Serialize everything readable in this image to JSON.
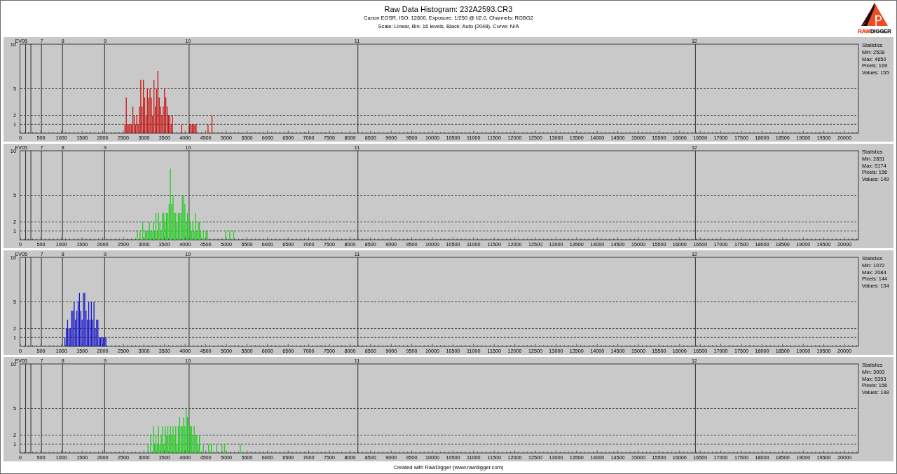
{
  "header": {
    "title": "Raw Data Histogram: 232A2593.CR3",
    "lines": [
      "Canon EOSR, ISO: 12800, Exposure: 1/250 @ f/2.0, Channels: RGBG2",
      "Scale: Linear, Bin: 16 levels, Black: Auto (2048), Curve: N/A"
    ]
  },
  "logo": {
    "wordmark": [
      {
        "text": "RAW",
        "color": "#e8421e"
      },
      {
        "text": "DIGGER",
        "color": "#222222"
      }
    ]
  },
  "panels": [
    {
      "chart_data": {
        "type": "bar",
        "x": [
          2528,
          2560,
          2592,
          2624,
          2656,
          2688,
          2720,
          2752,
          2784,
          2816,
          2848,
          2880,
          2912,
          2944,
          2976,
          3008,
          3040,
          3072,
          3104,
          3136,
          3168,
          3200,
          3232,
          3264,
          3296,
          3328,
          3360,
          3392,
          3424,
          3456,
          3488,
          3520,
          3552,
          3584,
          3616,
          3648,
          3680,
          3904,
          4096,
          4128,
          4160,
          4192,
          4224,
          4256,
          4544,
          4640
        ],
        "series": [
          {
            "color": "#c81414",
            "values": [
              1,
              4,
              1,
              1,
              1,
              1,
              3,
              2,
              1,
              2,
              1,
              3,
              6,
              3,
              6,
              4,
              2,
              5,
              4,
              5,
              4,
              2,
              6,
              3,
              5,
              7,
              4,
              3,
              2,
              3,
              5,
              4,
              3,
              2,
              2,
              1,
              2,
              1,
              1,
              1,
              1,
              1,
              1,
              1,
              1,
              2
            ]
          }
        ],
        "xlim": [
          0,
          20340
        ],
        "ylim": [
          0,
          10
        ],
        "grid": "y",
        "xticks": [
          0,
          500,
          1000,
          1500,
          2000,
          2500,
          3000,
          3500,
          4000,
          4500,
          5000,
          5500,
          6000,
          6500,
          7000,
          7500,
          8000,
          8500,
          9000,
          9500,
          10000,
          10500,
          11000,
          11500,
          12000,
          12500,
          13000,
          13500,
          14000,
          14500,
          15000,
          15500,
          16000,
          16500,
          17000,
          17500,
          18000,
          18500,
          19000,
          19500,
          20000
        ],
        "yticks": [
          1,
          2,
          5,
          10
        ],
        "ref_lines": [
          {
            "axis": "x",
            "value": 128
          },
          {
            "axis": "x",
            "value": 256
          },
          {
            "axis": "x",
            "value": 512
          },
          {
            "axis": "x",
            "value": 1024
          },
          {
            "axis": "x",
            "value": 2048
          },
          {
            "axis": "x",
            "value": 4096
          },
          {
            "axis": "x",
            "value": 8192
          },
          {
            "axis": "x",
            "value": 16384
          }
        ],
        "annotations": [
          {
            "x": 128,
            "y": 10,
            "text": "EV05"
          },
          {
            "x": 512,
            "y": 10,
            "text": "7"
          },
          {
            "x": 1024,
            "y": 10,
            "text": "8"
          },
          {
            "x": 2048,
            "y": 10,
            "text": "9"
          },
          {
            "x": 4096,
            "y": 10,
            "text": "10"
          },
          {
            "x": 8192,
            "y": 10,
            "text": "11"
          },
          {
            "x": 16384,
            "y": 10,
            "text": "12"
          }
        ]
      },
      "statistics": {
        "heading": "Statistics",
        "lines": [
          "Min: 2528",
          "Max: 4650",
          "Pixels: 169",
          "Values: 155"
        ]
      }
    },
    {
      "chart_data": {
        "type": "bar",
        "x": [
          2832,
          2896,
          2960,
          3024,
          3056,
          3088,
          3120,
          3152,
          3184,
          3216,
          3248,
          3280,
          3312,
          3344,
          3376,
          3408,
          3440,
          3472,
          3504,
          3536,
          3568,
          3600,
          3632,
          3664,
          3696,
          3728,
          3760,
          3792,
          3824,
          3856,
          3888,
          3920,
          3952,
          3984,
          4016,
          4048,
          4080,
          4112,
          4144,
          4176,
          4208,
          4240,
          4272,
          4304,
          4336,
          4368,
          4432,
          4496,
          4528,
          4976,
          5072,
          5168
        ],
        "series": [
          {
            "color": "#22cc22",
            "values": [
              1,
              1,
              2,
              1,
              1,
              1,
              2,
              1,
              1,
              2,
              1,
              3,
              1,
              3,
              2,
              1,
              3,
              3,
              2,
              3,
              3,
              4,
              8,
              4,
              5,
              3,
              3,
              2,
              3,
              3,
              3,
              5,
              5,
              4,
              2,
              3,
              3,
              2,
              1,
              2,
              1,
              3,
              1,
              2,
              2,
              1,
              1,
              1,
              1,
              1,
              1,
              1
            ]
          }
        ],
        "xlim": [
          0,
          20340
        ],
        "ylim": [
          0,
          10
        ],
        "grid": "y",
        "xticks": [
          0,
          500,
          1000,
          1500,
          2000,
          2500,
          3000,
          3500,
          4000,
          4500,
          5000,
          5500,
          6000,
          6500,
          7000,
          7500,
          8000,
          8500,
          9000,
          9500,
          10000,
          10500,
          11000,
          11500,
          12000,
          12500,
          13000,
          13500,
          14000,
          14500,
          15000,
          15500,
          16000,
          16500,
          17000,
          17500,
          18000,
          18500,
          19000,
          19500,
          20000
        ],
        "yticks": [
          1,
          2,
          5,
          10
        ],
        "ref_lines": [
          {
            "axis": "x",
            "value": 128
          },
          {
            "axis": "x",
            "value": 256
          },
          {
            "axis": "x",
            "value": 512
          },
          {
            "axis": "x",
            "value": 1024
          },
          {
            "axis": "x",
            "value": 2048
          },
          {
            "axis": "x",
            "value": 4096
          },
          {
            "axis": "x",
            "value": 8192
          },
          {
            "axis": "x",
            "value": 16384
          }
        ],
        "annotations": [
          {
            "x": 128,
            "y": 10,
            "text": "EV05"
          },
          {
            "x": 512,
            "y": 10,
            "text": "7"
          },
          {
            "x": 1024,
            "y": 10,
            "text": "8"
          },
          {
            "x": 2048,
            "y": 10,
            "text": "9"
          },
          {
            "x": 4096,
            "y": 10,
            "text": "10"
          },
          {
            "x": 8192,
            "y": 10,
            "text": "11"
          },
          {
            "x": 16384,
            "y": 10,
            "text": "12"
          }
        ]
      },
      "statistics": {
        "heading": "Statistics",
        "lines": [
          "Min: 2831",
          "Max: 5174",
          "Pixels: 156",
          "Values: 149"
        ]
      }
    },
    {
      "chart_data": {
        "type": "bar",
        "x": [
          1072,
          1104,
          1136,
          1168,
          1200,
          1232,
          1264,
          1296,
          1328,
          1360,
          1392,
          1424,
          1456,
          1488,
          1520,
          1552,
          1584,
          1616,
          1648,
          1680,
          1712,
          1744,
          1776,
          1808,
          1840,
          1872,
          1904,
          1936,
          1968,
          2000,
          2032,
          2064
        ],
        "series": [
          {
            "color": "#1414c8",
            "values": [
              1,
              2,
              3,
              2,
              2,
              4,
              4,
              5,
              3,
              4,
              5,
              6,
              4,
              3,
              6,
              6,
              4,
              3,
              5,
              3,
              5,
              3,
              5,
              2,
              3,
              3,
              1,
              1,
              1,
              1,
              1,
              1
            ]
          }
        ],
        "xlim": [
          0,
          20340
        ],
        "ylim": [
          0,
          10
        ],
        "grid": "y",
        "xticks": [
          0,
          500,
          1000,
          1500,
          2000,
          2500,
          3000,
          3500,
          4000,
          4500,
          5000,
          5500,
          6000,
          6500,
          7000,
          7500,
          8000,
          8500,
          9000,
          9500,
          10000,
          10500,
          11000,
          11500,
          12000,
          12500,
          13000,
          13500,
          14000,
          14500,
          15000,
          15500,
          16000,
          16500,
          17000,
          17500,
          18000,
          18500,
          19000,
          19500,
          20000
        ],
        "yticks": [
          1,
          2,
          5,
          10
        ],
        "ref_lines": [
          {
            "axis": "x",
            "value": 128
          },
          {
            "axis": "x",
            "value": 256
          },
          {
            "axis": "x",
            "value": 512
          },
          {
            "axis": "x",
            "value": 1024
          },
          {
            "axis": "x",
            "value": 2048
          },
          {
            "axis": "x",
            "value": 4096
          },
          {
            "axis": "x",
            "value": 8192
          },
          {
            "axis": "x",
            "value": 16384
          }
        ],
        "annotations": [
          {
            "x": 128,
            "y": 10,
            "text": "EV05"
          },
          {
            "x": 512,
            "y": 10,
            "text": "7"
          },
          {
            "x": 1024,
            "y": 10,
            "text": "8"
          },
          {
            "x": 2048,
            "y": 10,
            "text": "9"
          },
          {
            "x": 4096,
            "y": 10,
            "text": "10"
          },
          {
            "x": 8192,
            "y": 10,
            "text": "11"
          },
          {
            "x": 16384,
            "y": 10,
            "text": "12"
          }
        ]
      },
      "statistics": {
        "heading": "Statistics",
        "lines": [
          "Min: 1072",
          "Max: 2084",
          "Pixels: 144",
          "Values: 134"
        ]
      }
    },
    {
      "chart_data": {
        "type": "bar",
        "x": [
          3088,
          3152,
          3216,
          3248,
          3280,
          3312,
          3344,
          3376,
          3408,
          3440,
          3472,
          3504,
          3536,
          3568,
          3600,
          3632,
          3664,
          3696,
          3728,
          3760,
          3792,
          3824,
          3856,
          3888,
          3920,
          3952,
          3984,
          4016,
          4048,
          4080,
          4112,
          4144,
          4176,
          4208,
          4240,
          4272,
          4304,
          4336,
          4432,
          4560,
          4624,
          4752,
          4880,
          4944,
          5328
        ],
        "series": [
          {
            "color": "#22cc22",
            "values": [
              1,
              2,
              3,
              1,
              2,
              1,
              3,
              1,
              2,
              3,
              1,
              3,
              2,
              3,
              2,
              3,
              2,
              3,
              2,
              3,
              1,
              3,
              4,
              3,
              3,
              4,
              3,
              5,
              4,
              3,
              3,
              3,
              2,
              3,
              2,
              2,
              1,
              2,
              1,
              1,
              1,
              1,
              1,
              1,
              1
            ]
          }
        ],
        "xlim": [
          0,
          20340
        ],
        "ylim": [
          0,
          10
        ],
        "grid": "y",
        "xticks": [
          0,
          500,
          1000,
          1500,
          2000,
          2500,
          3000,
          3500,
          4000,
          4500,
          5000,
          5500,
          6000,
          6500,
          7000,
          7500,
          8000,
          8500,
          9000,
          9500,
          10000,
          10500,
          11000,
          11500,
          12000,
          12500,
          13000,
          13500,
          14000,
          14500,
          15000,
          15500,
          16000,
          16500,
          17000,
          17500,
          18000,
          18500,
          19000,
          19500,
          20000
        ],
        "yticks": [
          1,
          2,
          5,
          10
        ],
        "ref_lines": [
          {
            "axis": "x",
            "value": 128
          },
          {
            "axis": "x",
            "value": 256
          },
          {
            "axis": "x",
            "value": 512
          },
          {
            "axis": "x",
            "value": 1024
          },
          {
            "axis": "x",
            "value": 2048
          },
          {
            "axis": "x",
            "value": 4096
          },
          {
            "axis": "x",
            "value": 8192
          },
          {
            "axis": "x",
            "value": 16384
          }
        ],
        "annotations": [
          {
            "x": 128,
            "y": 10,
            "text": "EV05"
          },
          {
            "x": 512,
            "y": 10,
            "text": "7"
          },
          {
            "x": 1024,
            "y": 10,
            "text": "8"
          },
          {
            "x": 2048,
            "y": 10,
            "text": "9"
          },
          {
            "x": 4096,
            "y": 10,
            "text": "10"
          },
          {
            "x": 8192,
            "y": 10,
            "text": "11"
          },
          {
            "x": 16384,
            "y": 10,
            "text": "12"
          }
        ]
      },
      "statistics": {
        "heading": "Statistics",
        "lines": [
          "Min: 3093",
          "Max: 5353",
          "Pixels: 156",
          "Values: 148"
        ]
      }
    }
  ],
  "footer": "Created with RawDigger (www.rawdigger.com)"
}
